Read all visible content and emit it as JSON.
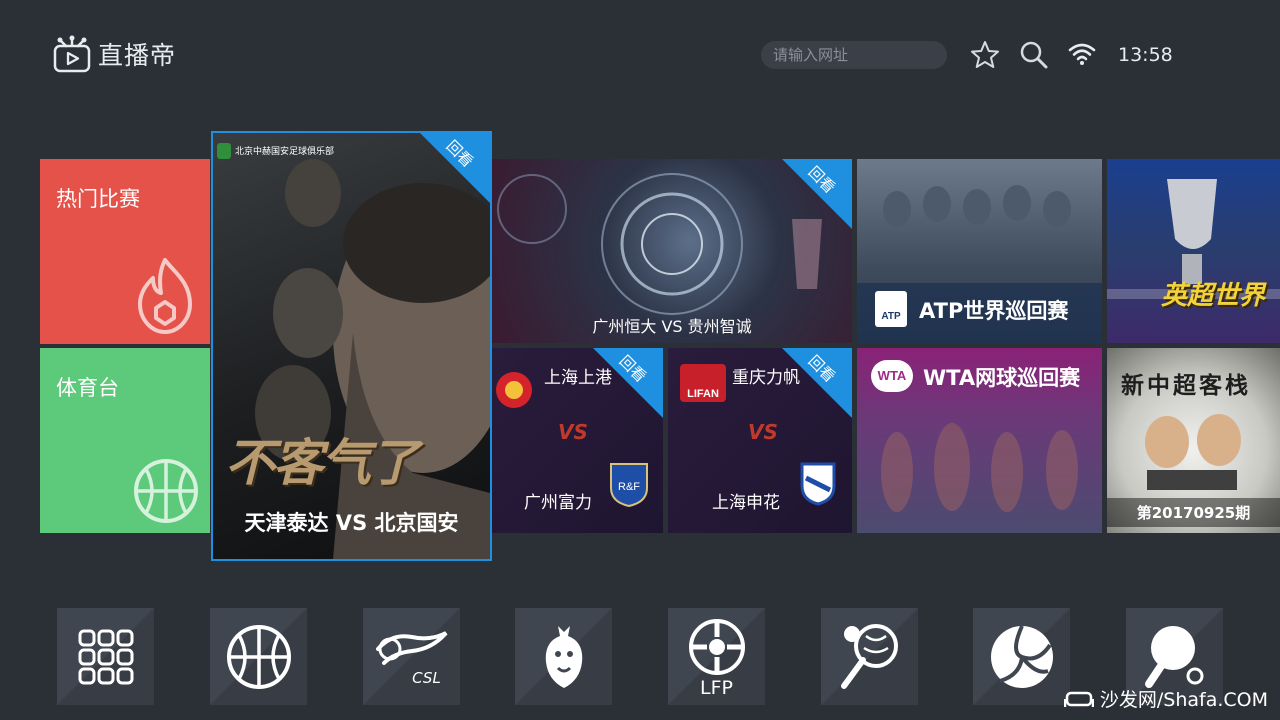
{
  "header": {
    "app_name": "直播帝",
    "search_placeholder": "请输入网址",
    "time": "13:58"
  },
  "categories": [
    {
      "label": "热门比赛",
      "icon": "flame-icon",
      "color": "#e5524a"
    },
    {
      "label": "体育台",
      "icon": "basketball-icon",
      "color": "#5dc97a"
    }
  ],
  "featured": {
    "club_logo_text": "北京中赫国安足球俱乐部",
    "slogan": "不客气了",
    "caption": "天津泰达 VS 北京国安",
    "badge": "回看"
  },
  "matches": [
    {
      "caption": "广州恒大 VS 贵州智诚",
      "badge": "回看"
    },
    {
      "home": "上海上港",
      "away": "广州富力",
      "vs": "VS",
      "badge": "回看"
    },
    {
      "home": "重庆力帆",
      "away": "上海申花",
      "vs": "VS",
      "badge": "回看",
      "home_logo_text": "LIFAN"
    }
  ],
  "tours": [
    {
      "title": "ATP世界巡回赛",
      "logo": "ATP"
    },
    {
      "title": "WTA网球巡回赛",
      "logo": "WTA"
    }
  ],
  "extras": [
    {
      "title": "英超世界"
    },
    {
      "title": "新中超客栈",
      "caption": "第20170925期"
    }
  ],
  "shortcuts": [
    {
      "name": "all-apps",
      "label": ""
    },
    {
      "name": "basketball",
      "label": ""
    },
    {
      "name": "csl",
      "label": "CSL"
    },
    {
      "name": "premier-league",
      "label": ""
    },
    {
      "name": "laliga",
      "label": "LFP"
    },
    {
      "name": "tennis",
      "label": ""
    },
    {
      "name": "volleyball",
      "label": ""
    },
    {
      "name": "table-tennis",
      "label": ""
    }
  ],
  "watermark": "沙发网/Shafa.COM",
  "colors": {
    "accent": "#1f8fe0",
    "hot": "#e5524a",
    "sports": "#5dc97a",
    "wta": "#a02a8a"
  }
}
